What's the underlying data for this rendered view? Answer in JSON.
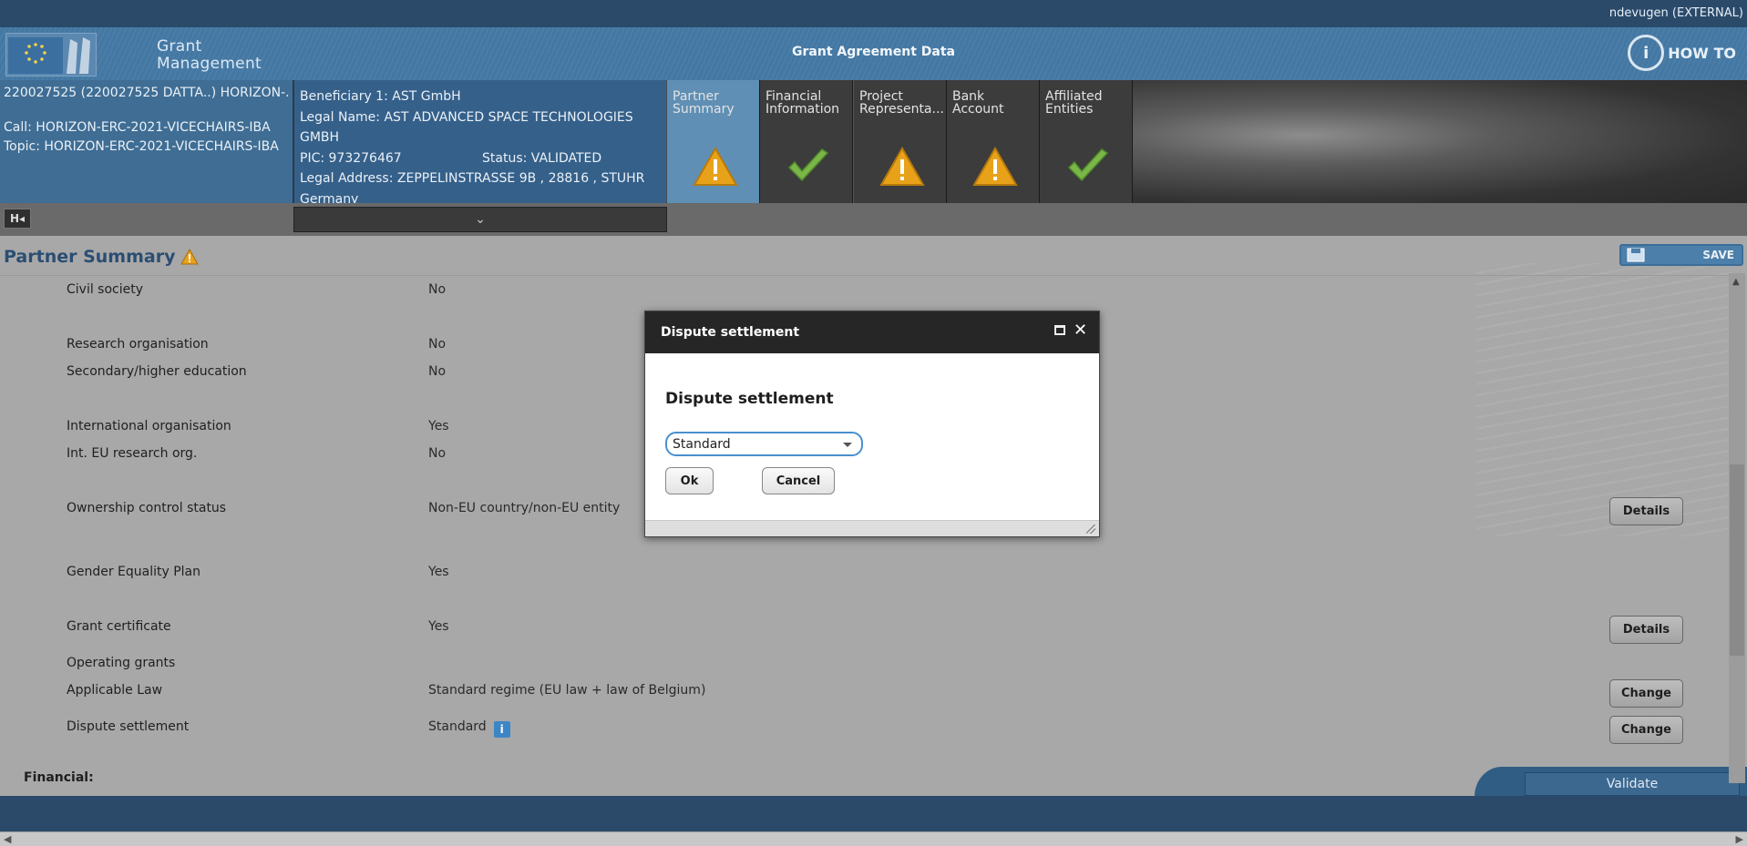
{
  "userbar": {
    "user": "ndevugen (EXTERNAL)"
  },
  "header": {
    "brand_line1": "Grant",
    "brand_line2": "Management",
    "title": "Grant Agreement Data",
    "howto": "HOW TO"
  },
  "project": {
    "line1": "220027525 (220027525 DATTA..) HORIZON-...",
    "call": "Call: HORIZON-ERC-2021-VICECHAIRS-IBA",
    "topic": "Topic: HORIZON-ERC-2021-VICECHAIRS-IBA"
  },
  "beneficiary": {
    "name": "Beneficiary 1: AST GmbH",
    "legal_name": "Legal Name: AST ADVANCED SPACE TECHNOLOGIES GMBH",
    "pic": "PIC: 973276467",
    "status": "Status: VALIDATED",
    "address": "Legal Address: ZEPPELINSTRASSE 9B , 28816 , STUHR",
    "country": "Germany"
  },
  "tabs": [
    {
      "line1": "Partner",
      "line2": "Summary",
      "icon": "warning-icon"
    },
    {
      "line1": "Financial",
      "line2": "Information",
      "icon": "check-icon"
    },
    {
      "line1": "Project",
      "line2": "Representa...",
      "icon": "warning-icon"
    },
    {
      "line1": "Bank",
      "line2": "Account",
      "icon": "warning-icon"
    },
    {
      "line1": "Affiliated",
      "line2": "Entities",
      "icon": "check-icon"
    }
  ],
  "page": {
    "title": "Partner Summary",
    "save_label": "SAVE"
  },
  "rows": [
    {
      "label": "Civil society",
      "value": "No"
    },
    {
      "label": "Research organisation",
      "value": "No"
    },
    {
      "label": "Secondary/higher education",
      "value": "No"
    },
    {
      "label": "International organisation",
      "value": "Yes"
    },
    {
      "label": "Int. EU research org.",
      "value": "No"
    },
    {
      "label": "Ownership control status",
      "value": "Non-EU country/non-EU entity",
      "button": "Details"
    },
    {
      "label": "Gender Equality Plan",
      "value": "Yes"
    },
    {
      "label": "Grant certificate",
      "value": "Yes",
      "button": "Details"
    },
    {
      "label": "Operating grants",
      "value": ""
    },
    {
      "label": "Applicable Law",
      "value": "Standard regime (EU law + law of Belgium)",
      "button": "Change"
    },
    {
      "label": "Dispute settlement",
      "value": "Standard",
      "button": "Change"
    }
  ],
  "financial_label": "Financial:",
  "validate_label": "Validate",
  "dialog": {
    "title": "Dispute settlement",
    "heading": "Dispute settlement",
    "selected": "Standard",
    "ok": "Ok",
    "cancel": "Cancel"
  },
  "colors": {
    "header_blue": "#4478a3",
    "warning": "#e8a21a",
    "check": "#7ab648"
  }
}
